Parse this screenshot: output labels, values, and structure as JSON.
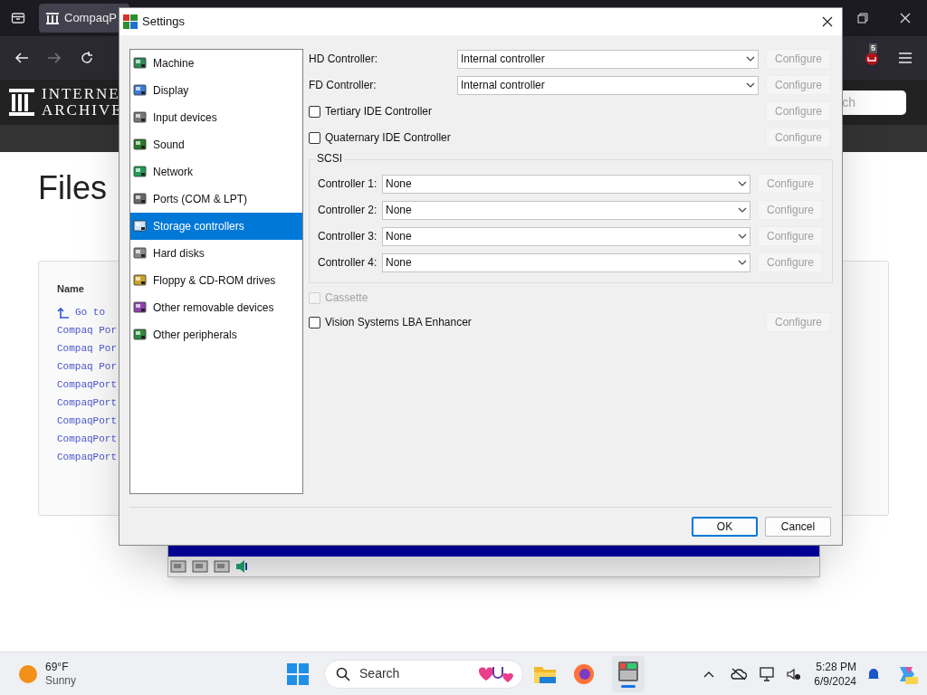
{
  "browser": {
    "tab_title": "CompaqP",
    "badge": "5",
    "search_placeholder": "ch"
  },
  "site": {
    "logo_line1": "INTERNE",
    "logo_line2": "ARCHIVE",
    "heading": "Files",
    "table_header": "Name",
    "rows": [
      {
        "kind": "parent",
        "text": "Go to"
      },
      {
        "kind": "file",
        "text": "Compaq Por"
      },
      {
        "kind": "file",
        "text": "Compaq Por"
      },
      {
        "kind": "file",
        "text": "Compaq Por"
      },
      {
        "kind": "file",
        "text": "CompaqPort"
      },
      {
        "kind": "file",
        "text": "CompaqPort"
      },
      {
        "kind": "file",
        "text": "CompaqPort"
      },
      {
        "kind": "file",
        "text": "CompaqPort"
      },
      {
        "kind": "file",
        "text": "CompaqPort"
      }
    ]
  },
  "dialog": {
    "title": "Settings",
    "categories": [
      {
        "label": "Machine",
        "selected": false
      },
      {
        "label": "Display",
        "selected": false
      },
      {
        "label": "Input devices",
        "selected": false
      },
      {
        "label": "Sound",
        "selected": false
      },
      {
        "label": "Network",
        "selected": false
      },
      {
        "label": "Ports (COM & LPT)",
        "selected": false
      },
      {
        "label": "Storage controllers",
        "selected": true
      },
      {
        "label": "Hard disks",
        "selected": false
      },
      {
        "label": "Floppy & CD-ROM drives",
        "selected": false
      },
      {
        "label": "Other removable devices",
        "selected": false
      },
      {
        "label": "Other peripherals",
        "selected": false
      }
    ],
    "rows": [
      {
        "kind": "select",
        "label": "HD Controller:",
        "value": "Internal controller",
        "button": {
          "label": "Configure",
          "disabled": true
        }
      },
      {
        "kind": "select",
        "label": "FD Controller:",
        "value": "Internal controller",
        "button": {
          "label": "Configure",
          "disabled": true
        }
      },
      {
        "kind": "checkbox",
        "label": "Tertiary IDE Controller",
        "checked": false,
        "disabled": false,
        "button": {
          "label": "Configure",
          "disabled": true
        }
      },
      {
        "kind": "checkbox",
        "label": "Quaternary IDE Controller",
        "checked": false,
        "disabled": false,
        "button": {
          "label": "Configure",
          "disabled": true
        }
      }
    ],
    "scsi": {
      "title": "SCSI",
      "controllers": [
        {
          "label": "Controller 1:",
          "value": "None",
          "button": {
            "label": "Configure",
            "disabled": true
          }
        },
        {
          "label": "Controller 2:",
          "value": "None",
          "button": {
            "label": "Configure",
            "disabled": true
          }
        },
        {
          "label": "Controller 3:",
          "value": "None",
          "button": {
            "label": "Configure",
            "disabled": true
          }
        },
        {
          "label": "Controller 4:",
          "value": "None",
          "button": {
            "label": "Configure",
            "disabled": true
          }
        }
      ]
    },
    "extras": [
      {
        "label": "Cassette",
        "checked": false,
        "disabled": true
      },
      {
        "label": "Vision Systems LBA Enhancer",
        "checked": false,
        "disabled": false,
        "button": {
          "label": "Configure",
          "disabled": true
        }
      }
    ],
    "buttons": [
      {
        "label": "OK",
        "default": true
      },
      {
        "label": "Cancel",
        "default": false
      }
    ]
  },
  "taskbar": {
    "temperature": "69°F",
    "condition": "Sunny",
    "search": "Search",
    "time": "5:28 PM",
    "date": "6/9/2024"
  }
}
